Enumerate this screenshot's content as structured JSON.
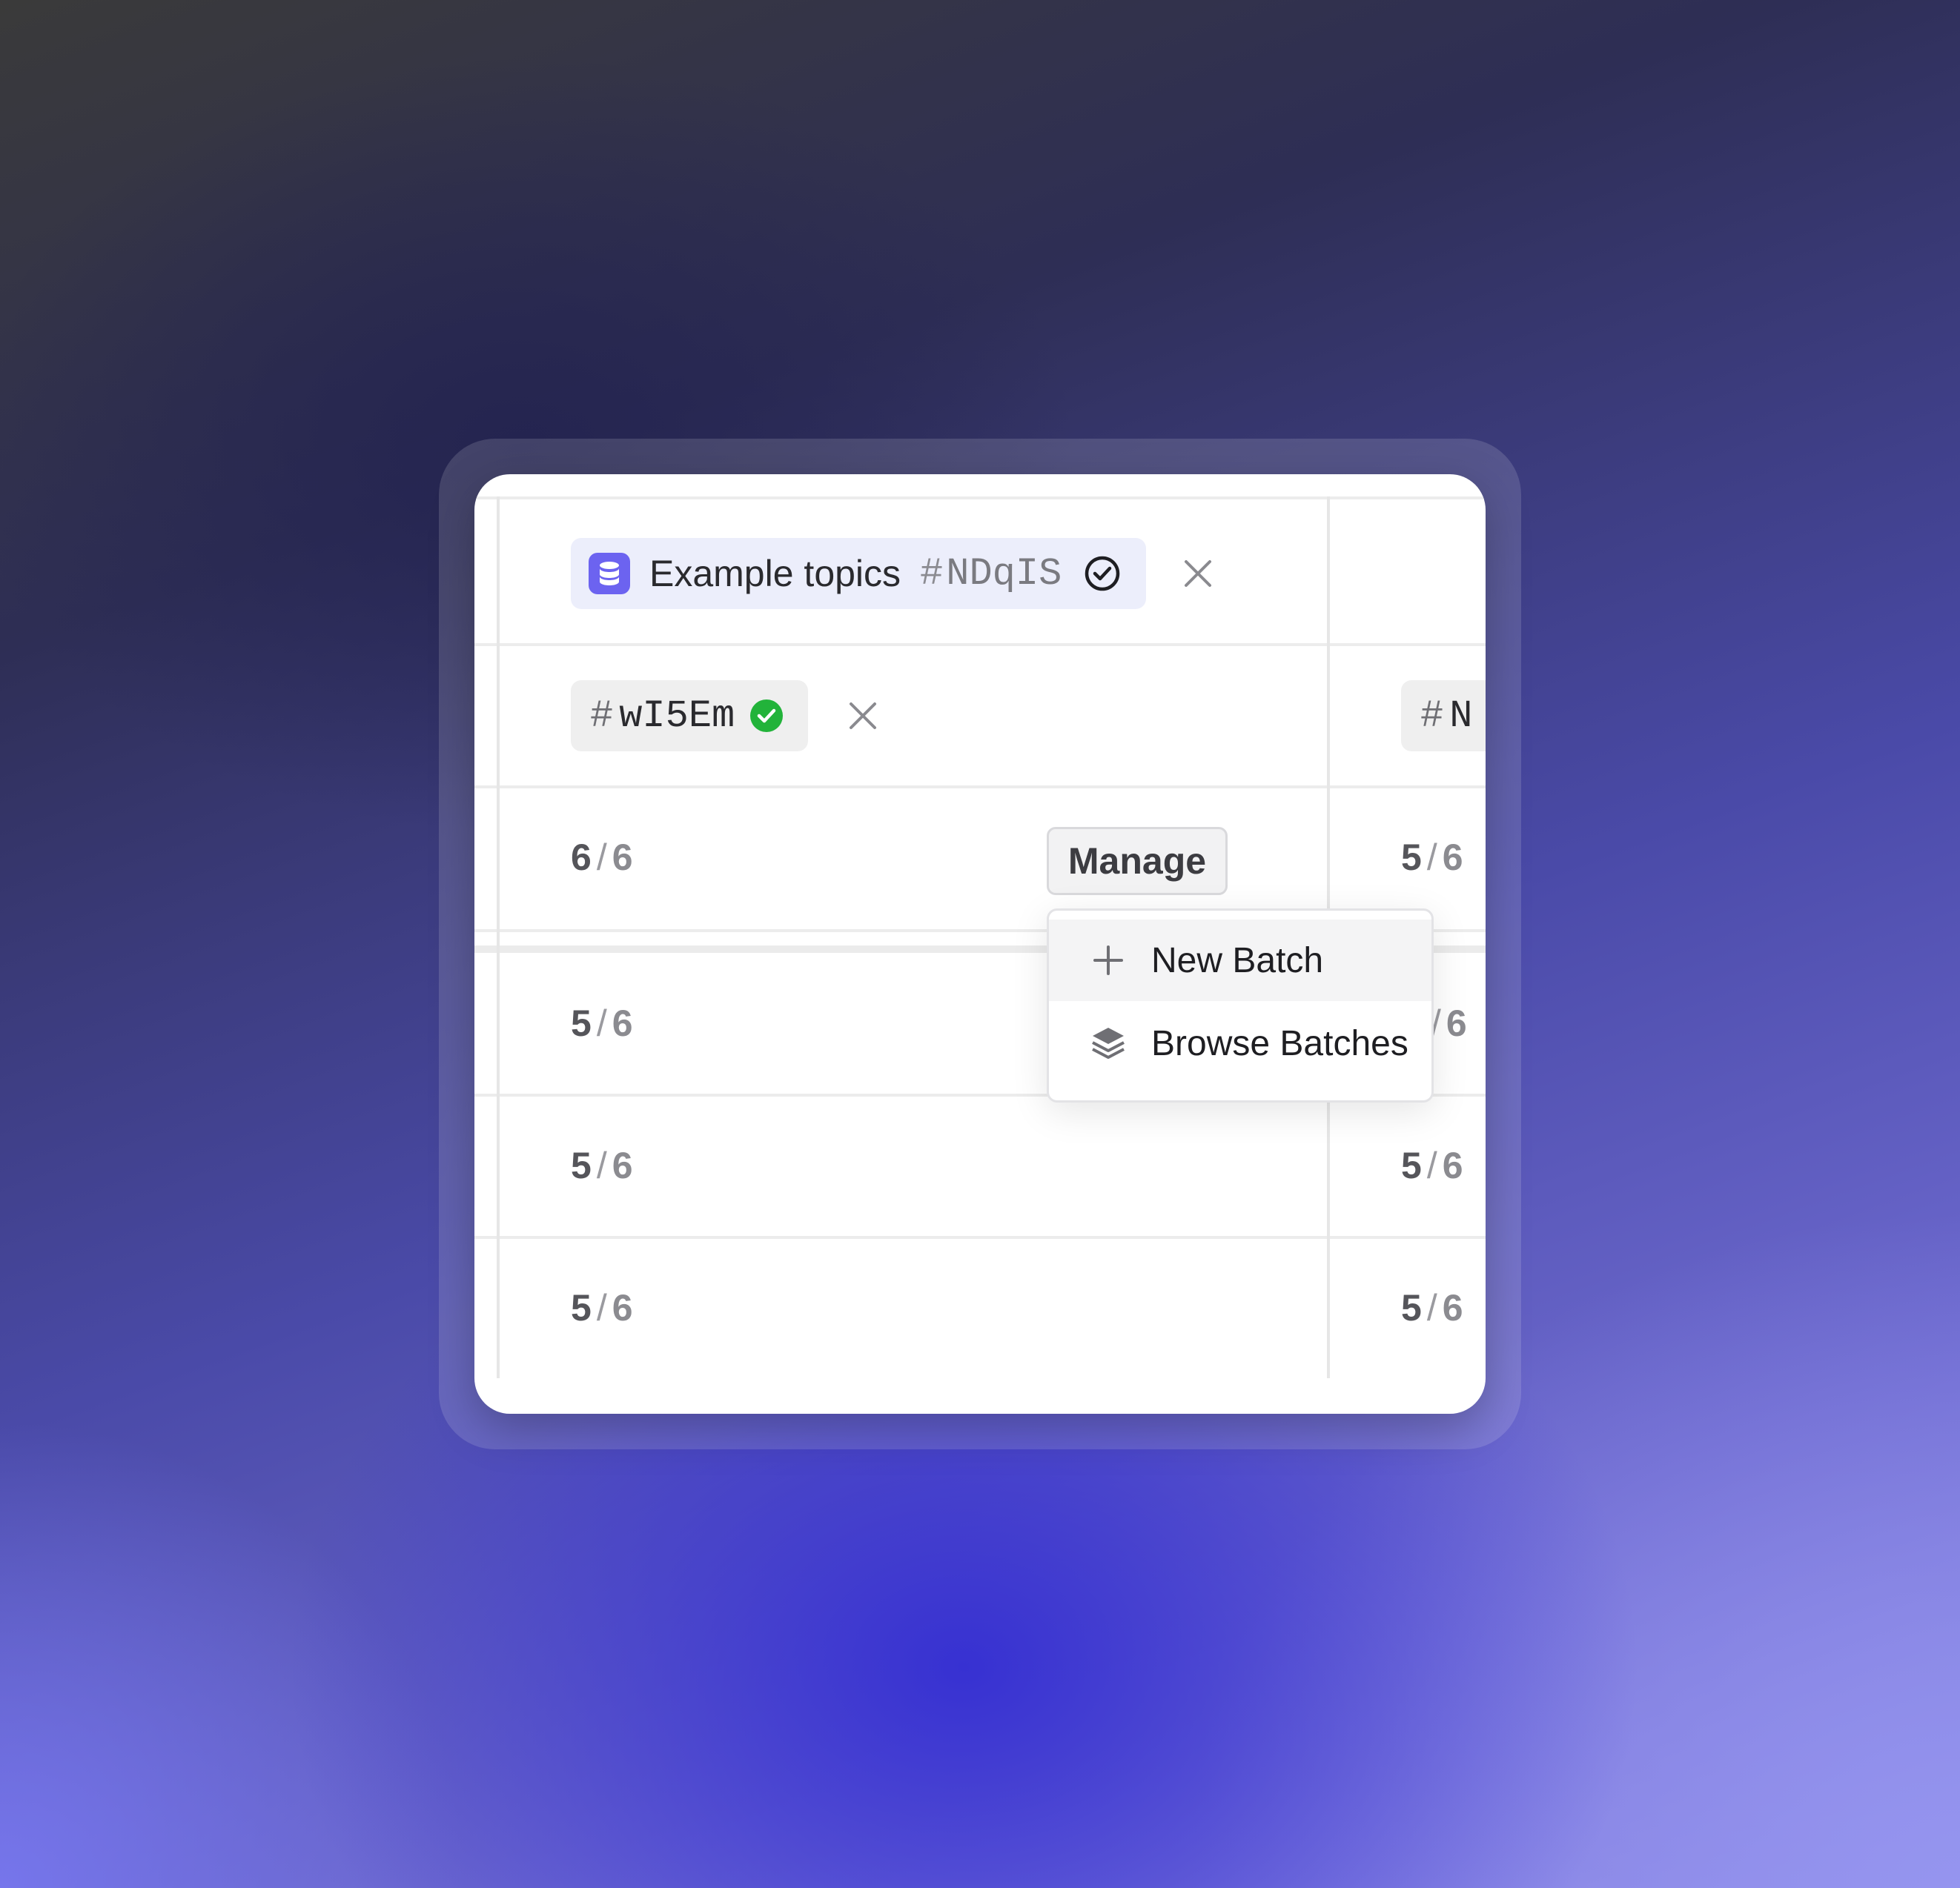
{
  "topic_chip": {
    "title": "Example topics",
    "hash": "#",
    "id": "NDqIS"
  },
  "batch_chips": [
    {
      "hash": "#",
      "id": "wI5Em"
    },
    {
      "hash": "#",
      "id": "N"
    }
  ],
  "rows": [
    {
      "left": {
        "num": "6",
        "sep": "/",
        "den": "6"
      },
      "right": {
        "num": "5",
        "sep": "/",
        "den": "6"
      }
    },
    {
      "left": {
        "num": "5",
        "sep": "/",
        "den": "6"
      },
      "right": {
        "num": "",
        "sep": "/",
        "den": "6"
      }
    },
    {
      "left": {
        "num": "5",
        "sep": "/",
        "den": "6"
      },
      "right": {
        "num": "5",
        "sep": "/",
        "den": "6"
      }
    },
    {
      "left": {
        "num": "5",
        "sep": "/",
        "den": "6"
      },
      "right": {
        "num": "5",
        "sep": "/",
        "den": "6"
      }
    }
  ],
  "manage_button": {
    "label": "Manage"
  },
  "menu": {
    "items": [
      {
        "label": "New Batch",
        "icon": "plus-icon"
      },
      {
        "label": "Browse Batches",
        "icon": "layers-icon"
      }
    ]
  },
  "colors": {
    "accent": "#6c63f0",
    "success": "#22b33a"
  }
}
